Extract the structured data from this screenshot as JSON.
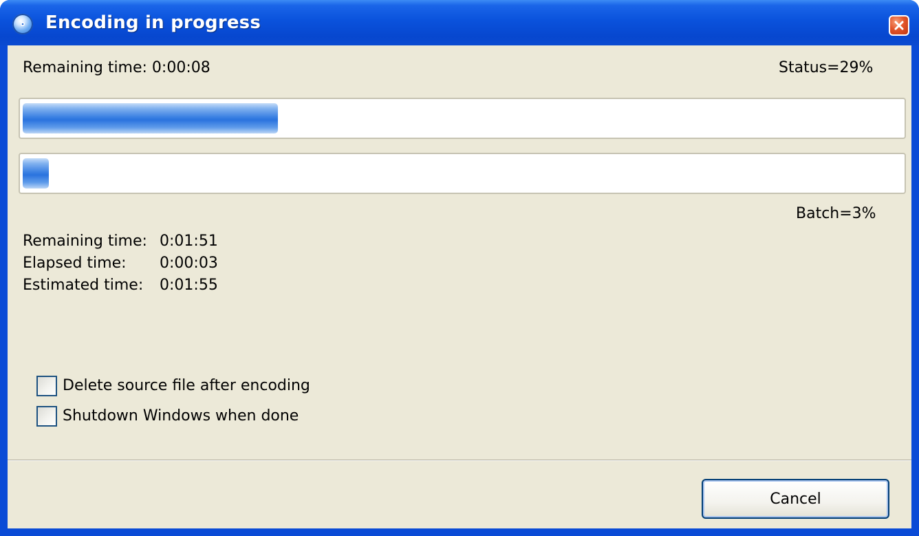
{
  "window": {
    "title": "Encoding in progress",
    "accent_color": "#0a4bd6",
    "icon": "media-disc-icon",
    "close_icon": "close-icon"
  },
  "file_progress": {
    "remaining_label": "Remaining time: 0:00:08",
    "status_label": "Status=29%",
    "percent": 29
  },
  "batch_progress": {
    "percent": 3,
    "batch_label": "Batch=3%"
  },
  "times": {
    "remaining_label": "Remaining time:",
    "remaining_value": "0:01:51",
    "elapsed_label": "Elapsed time:",
    "elapsed_value": "0:00:03",
    "estimated_label": "Estimated time:",
    "estimated_value": "0:01:55"
  },
  "options": [
    {
      "label": "Delete source file after encoding",
      "checked": false
    },
    {
      "label": "Shutdown Windows when done",
      "checked": false
    }
  ],
  "buttons": {
    "cancel_label": "Cancel"
  }
}
